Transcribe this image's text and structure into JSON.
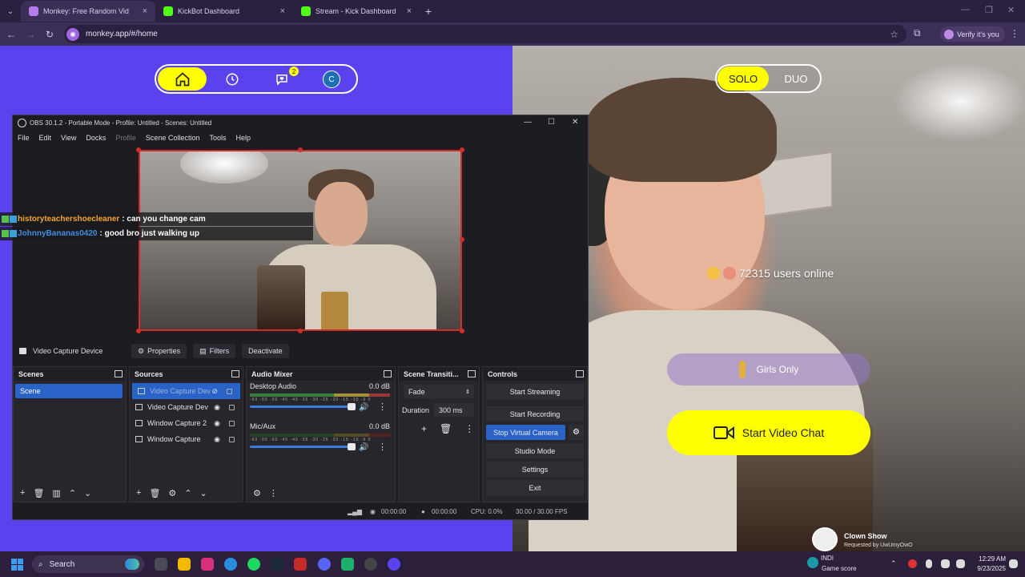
{
  "browser": {
    "tabs": [
      {
        "title": "Monkey: Free Random Vid",
        "active": true
      },
      {
        "title": "KickBot Dashboard",
        "active": false
      },
      {
        "title": "Stream - Kick Dashboard",
        "active": false
      }
    ],
    "url": "monkey.app/#/home",
    "verify_label": "Verify it's you"
  },
  "monkey": {
    "nav_badge_count": "2",
    "avatar_letter": "C",
    "modes": {
      "solo": "SOLO",
      "duo": "DUO"
    },
    "online_text": "72315 users online",
    "girls_only_label": "Girls Only",
    "start_video_chat_label": "Start Video Chat",
    "accent_color": "#ffff00",
    "brand_purple": "#5a43ee"
  },
  "obs": {
    "title": "OBS 30.1.2 - Portable Mode - Profile: Untitled - Scenes: Untitled",
    "menu": [
      "File",
      "Edit",
      "View",
      "Docks",
      "Profile",
      "Scene Collection",
      "Tools",
      "Help"
    ],
    "source_bar": {
      "source_name": "Video Capture Device",
      "properties": "Properties",
      "filters": "Filters",
      "deactivate": "Deactivate"
    },
    "docks": {
      "scenes": {
        "title": "Scenes",
        "items": [
          "Scene"
        ]
      },
      "sources": {
        "title": "Sources",
        "items": [
          "Video Capture Dev",
          "Video Capture Dev",
          "Window Capture 2",
          "Window Capture"
        ]
      },
      "audio": {
        "title": "Audio Mixer",
        "channels": [
          {
            "name": "Desktop Audio",
            "db": "0.0 dB"
          },
          {
            "name": "Mic/Aux",
            "db": "0.0 dB"
          }
        ],
        "scale": "-60 -55 -50 -45 -40 -35 -30 -25 -20 -15 -10 -5 0"
      },
      "transitions": {
        "title": "Scene Transiti...",
        "selected": "Fade",
        "duration_label": "Duration",
        "duration_value": "300 ms"
      },
      "controls": {
        "title": "Controls",
        "start_streaming": "Start Streaming",
        "start_recording": "Start Recording",
        "stop_virtual_camera": "Stop Virtual Camera",
        "studio_mode": "Studio Mode",
        "settings": "Settings",
        "exit": "Exit"
      }
    },
    "status": {
      "stream_time": "00:00:00",
      "rec_time": "00:00:00",
      "cpu": "CPU: 0.0%",
      "fps": "30.00 / 30.00 FPS"
    }
  },
  "chat": [
    {
      "user": "historyteachershoecleaner",
      "message": ": can you change cam"
    },
    {
      "user": "JohnnyBananas0420",
      "message": ": good bro just walking up"
    }
  ],
  "alert": {
    "title": "Clown Show",
    "subtitle": "Requested by UwUmyOwO"
  },
  "taskbar": {
    "search_label": "Search",
    "game_score_top": "INDI",
    "game_score_label": "Game score",
    "time": "12:29 AM",
    "date": "9/23/2025"
  }
}
